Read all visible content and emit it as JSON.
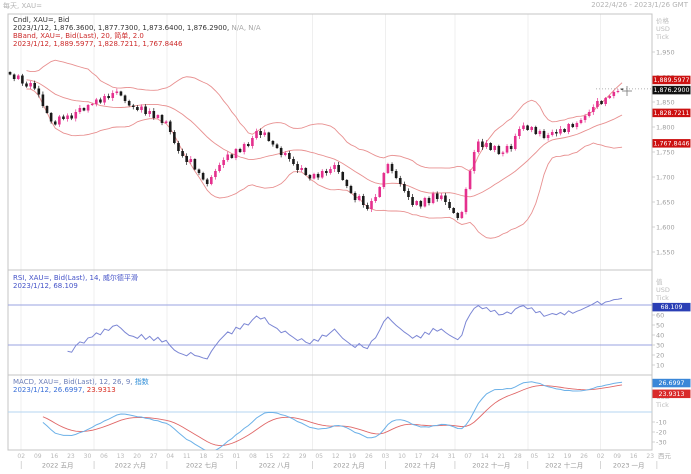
{
  "header": {
    "left": "每天, XAU=",
    "right": "2022/4/26 - 2023/1/26 GMT"
  },
  "legend": {
    "candle_line1": "Cndl, XAU=, Bid",
    "candle_line2": "2023/1/12, 1,876.3600, 1,877.7300, 1,873.6400, 1,876.2900,",
    "candle_line2_na": " N/A, N/A",
    "bband_line1": "BBand, XAU=, Bid(Last), 20, 简单, 2.0",
    "bband_line2": "2023/1/12, 1,889.5977, 1,828.7211, 1,767.8446",
    "rsi_line1": "RSI, XAU=, Bid(Last), 14, 威尔德平滑",
    "rsi_line2": "2023/1/12, 68.109",
    "macd_line1_prefix": "MACD, XAU=, Bid(Last), 12, 26, 9, ",
    "macd_line1_method": "指数",
    "macd_line2_left": "2023/1/12, 26.6997,",
    "macd_line2_signal": " 23.9313"
  },
  "badges": {
    "bb_upper": "1,889.5977",
    "last_price": "1,876.2900",
    "bb_mid": "1,828.7211",
    "bb_lower": "1,767.8446",
    "rsi": "68.109",
    "macd": "26.6997",
    "macd_signal": "23.9313"
  },
  "colors": {
    "up_candle": "#e5308e",
    "down_candle": "#1a1a1a",
    "bband": "#e89090",
    "rsi_line": "#7b86d4",
    "rsi_guide": "#9aa3e0",
    "macd_line": "#6cb1e8",
    "signal_line": "#e06868",
    "zero_line": "#b5d6f0",
    "frame": "#c4c4c4",
    "grid": "#efefef",
    "axis_text": "#a0a0a0",
    "badge_red": "#cc1111",
    "badge_black": "#111111",
    "badge_rsi": "#2b3fb5",
    "badge_macd_blue": "#3a87d8",
    "badge_macd_red": "#d92b2b"
  },
  "chart_data": {
    "type": "candlestick",
    "symbol": "XAU=",
    "interval": "daily",
    "title": "XAU= Daily with BBand(20,2), RSI(14), MACD(12,26,9)",
    "x_range_label": "2022/4/26 - 2023/1/26 GMT",
    "main_axis": {
      "unit_stack": [
        "价格",
        "USD",
        "Tick"
      ],
      "ticks": [
        1950,
        1900,
        1850,
        1800,
        1750,
        1700,
        1650,
        1600,
        1550
      ]
    },
    "last_candle": {
      "date": "2023/1/12",
      "open": 1876.36,
      "high": 1877.73,
      "low": 1873.64,
      "close": 1876.29
    },
    "closes": [
      1905,
      1896,
      1903,
      1887,
      1881,
      1888,
      1877,
      1865,
      1842,
      1828,
      1811,
      1805,
      1821,
      1816,
      1823,
      1817,
      1830,
      1838,
      1833,
      1844,
      1846,
      1855,
      1849,
      1862,
      1858,
      1868,
      1871,
      1863,
      1852,
      1843,
      1840,
      1834,
      1841,
      1826,
      1832,
      1818,
      1824,
      1808,
      1811,
      1790,
      1768,
      1752,
      1742,
      1730,
      1736,
      1715,
      1708,
      1695,
      1686,
      1700,
      1712,
      1724,
      1734,
      1745,
      1738,
      1756,
      1750,
      1766,
      1762,
      1778,
      1792,
      1784,
      1789,
      1772,
      1765,
      1758,
      1744,
      1748,
      1736,
      1726,
      1714,
      1718,
      1704,
      1697,
      1706,
      1699,
      1712,
      1708,
      1716,
      1724,
      1710,
      1694,
      1682,
      1668,
      1654,
      1662,
      1644,
      1636,
      1652,
      1660,
      1680,
      1708,
      1726,
      1712,
      1698,
      1686,
      1672,
      1660,
      1644,
      1652,
      1641,
      1658,
      1648,
      1667,
      1656,
      1663,
      1650,
      1638,
      1628,
      1618,
      1630,
      1676,
      1712,
      1750,
      1771,
      1760,
      1768,
      1754,
      1762,
      1746,
      1749,
      1762,
      1756,
      1782,
      1796,
      1803,
      1794,
      1800,
      1786,
      1792,
      1778,
      1784,
      1790,
      1787,
      1796,
      1790,
      1806,
      1800,
      1808,
      1814,
      1822,
      1830,
      1840,
      1852,
      1846,
      1858,
      1862,
      1870,
      1872,
      1876.29
    ],
    "overlays": [
      {
        "name": "BBand",
        "period": 20,
        "method": "简单",
        "deviation": 2.0,
        "last": {
          "upper": 1889.5977,
          "middle": 1828.7211,
          "lower": 1767.8446
        }
      }
    ],
    "indicators": [
      {
        "name": "RSI",
        "period": 14,
        "method": "威尔德平滑",
        "last": 68.109,
        "unit_stack": [
          "值",
          "USD",
          "Tick"
        ],
        "ticks": [
          60,
          50,
          40,
          30,
          20,
          10
        ],
        "guides": [
          70,
          30
        ]
      },
      {
        "name": "MACD",
        "fast": 12,
        "slow": 26,
        "signal_period": 9,
        "method": "指数",
        "last_macd": 26.6997,
        "last_signal": 23.9313,
        "unit_stack": [
          "USD",
          "Tick"
        ],
        "ticks": [
          -10,
          -20,
          -30
        ],
        "guides": [
          0
        ]
      }
    ],
    "x_axis": {
      "era_label": "西元",
      "weeks": [
        {
          "t": 4,
          "d": "02"
        },
        {
          "t": 9,
          "d": "09"
        },
        {
          "t": 14,
          "d": "16"
        },
        {
          "t": 19,
          "d": "23"
        },
        {
          "t": 24,
          "d": "30"
        },
        {
          "t": 29,
          "d": "06"
        },
        {
          "t": 34,
          "d": "13"
        },
        {
          "t": 39,
          "d": "20"
        },
        {
          "t": 44,
          "d": "27"
        },
        {
          "t": 49,
          "d": "04"
        },
        {
          "t": 54,
          "d": "11"
        },
        {
          "t": 59,
          "d": "18"
        },
        {
          "t": 64,
          "d": "25"
        },
        {
          "t": 69,
          "d": "01"
        },
        {
          "t": 74,
          "d": "08"
        },
        {
          "t": 79,
          "d": "15"
        },
        {
          "t": 84,
          "d": "22"
        },
        {
          "t": 89,
          "d": "29"
        },
        {
          "t": 94,
          "d": "05"
        },
        {
          "t": 99,
          "d": "12"
        },
        {
          "t": 104,
          "d": "19"
        },
        {
          "t": 109,
          "d": "26"
        },
        {
          "t": 114,
          "d": "03"
        },
        {
          "t": 119,
          "d": "10"
        },
        {
          "t": 124,
          "d": "17"
        },
        {
          "t": 129,
          "d": "24"
        },
        {
          "t": 134,
          "d": "31"
        },
        {
          "t": 139,
          "d": "07"
        },
        {
          "t": 144,
          "d": "14"
        },
        {
          "t": 149,
          "d": "21"
        },
        {
          "t": 154,
          "d": "28"
        },
        {
          "t": 159,
          "d": "05"
        },
        {
          "t": 164,
          "d": "12"
        },
        {
          "t": 169,
          "d": "19"
        },
        {
          "t": 174,
          "d": "26"
        },
        {
          "t": 179,
          "d": "02"
        },
        {
          "t": 184,
          "d": "09"
        },
        {
          "t": 189,
          "d": "16"
        },
        {
          "t": 194,
          "d": "23"
        }
      ],
      "months": [
        {
          "label": "2022 五月",
          "t0": 4,
          "t1": 26
        },
        {
          "label": "2022 六月",
          "t0": 26,
          "t1": 48
        },
        {
          "label": "2022 七月",
          "t0": 48,
          "t1": 69
        },
        {
          "label": "2022 八月",
          "t0": 69,
          "t1": 92
        },
        {
          "label": "2022 九月",
          "t0": 92,
          "t1": 114
        },
        {
          "label": "2022 十月",
          "t0": 114,
          "t1": 135
        },
        {
          "label": "2022 十一月",
          "t0": 135,
          "t1": 157
        },
        {
          "label": "2022 十二月",
          "t0": 157,
          "t1": 179
        },
        {
          "label": "2023 一月",
          "t0": 179,
          "t1": 196
        }
      ]
    }
  }
}
